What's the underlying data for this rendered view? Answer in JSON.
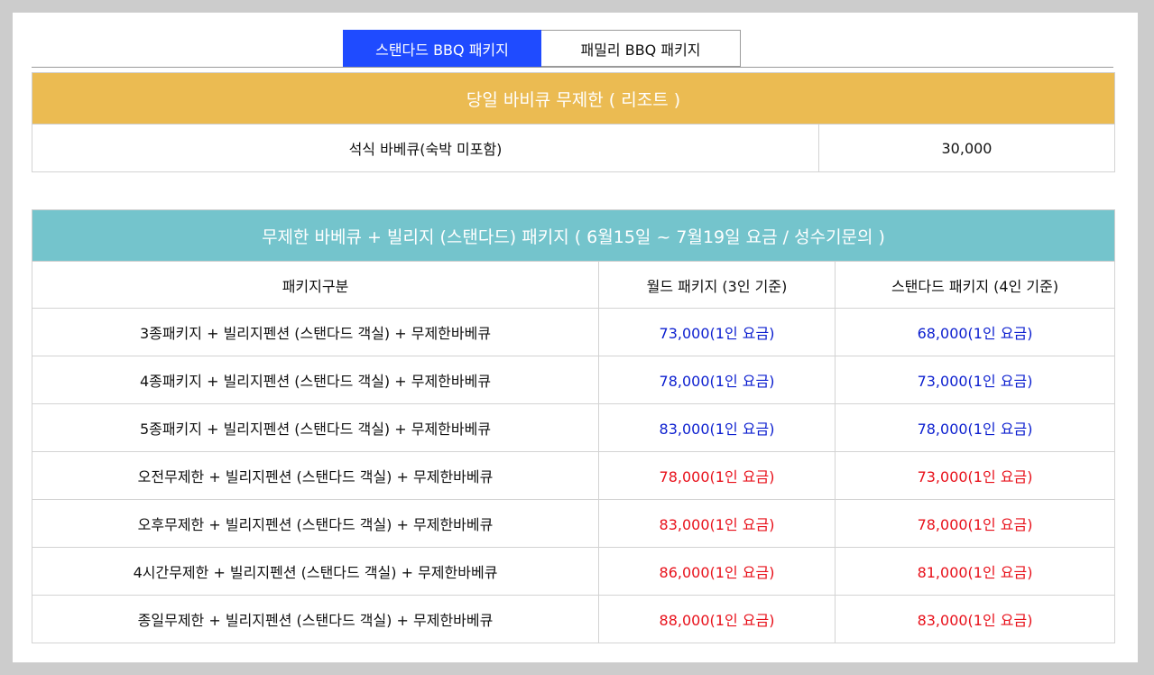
{
  "tabs": [
    {
      "label": "스탠다드 BBQ 패키지",
      "active": true
    },
    {
      "label": "패밀리 BBQ 패키지",
      "active": false
    }
  ],
  "table1": {
    "title": "당일 바비큐 무제한 ( 리조트 )",
    "rows": [
      {
        "name": "석식 바베큐(숙박 미포함)",
        "price": "30,000"
      }
    ]
  },
  "table2": {
    "title": "무제한 바베큐 + 빌리지 (스탠다드) 패키지 ( 6월15일 ~ 7월19일 요금 / 성수기문의 )",
    "headers": [
      "패키지구분",
      "월드 패키지 (3인 기준)",
      "스탠다드 패키지 (4인 기준)"
    ],
    "rows": [
      {
        "name": "3종패키지 + 빌리지펜션 (스탠다드 객실) + 무제한바베큐",
        "world": "73,000(1인 요금)",
        "standard": "68,000(1인 요금)",
        "color": "#0b1ecf"
      },
      {
        "name": "4종패키지 + 빌리지펜션 (스탠다드 객실) + 무제한바베큐",
        "world": "78,000(1인 요금)",
        "standard": "73,000(1인 요금)",
        "color": "#0b1ecf"
      },
      {
        "name": "5종패키지 + 빌리지펜션 (스탠다드 객실) + 무제한바베큐",
        "world": "83,000(1인 요금)",
        "standard": "78,000(1인 요금)",
        "color": "#0b1ecf"
      },
      {
        "name": "오전무제한 + 빌리지펜션 (스탠다드 객실) + 무제한바베큐",
        "world": "78,000(1인 요금)",
        "standard": "73,000(1인 요금)",
        "color": "#e8101a"
      },
      {
        "name": "오후무제한 + 빌리지펜션 (스탠다드 객실) + 무제한바베큐",
        "world": "83,000(1인 요금)",
        "standard": "78,000(1인 요금)",
        "color": "#e8101a"
      },
      {
        "name": "4시간무제한 + 빌리지펜션 (스탠다드 객실) + 무제한바베큐",
        "world": "86,000(1인 요금)",
        "standard": "81,000(1인 요금)",
        "color": "#e8101a"
      },
      {
        "name": "종일무제한 + 빌리지펜션 (스탠다드 객실) + 무제한바베큐",
        "world": "88,000(1인 요금)",
        "standard": "83,000(1인 요금)",
        "color": "#e8101a"
      }
    ]
  },
  "colors": {
    "tab_active": "#1f4bff",
    "table1_header": "#ebbb52",
    "table2_header": "#74c4cc",
    "price_blue": "#0b1ecf",
    "price_red": "#e8101a"
  }
}
